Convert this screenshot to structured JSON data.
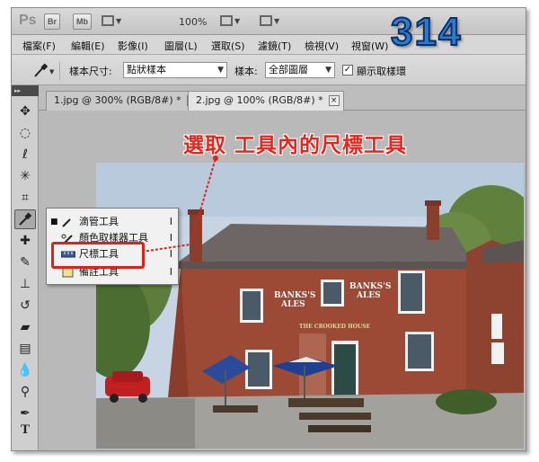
{
  "app": {
    "logo": "Ps",
    "bridge_button": "Br",
    "minibridge_button": "Mb",
    "zoom": "100%",
    "watermark": "314"
  },
  "menu": {
    "items": [
      "檔案(F)",
      "編輯(E)",
      "影像(I)",
      "圖層(L)",
      "選取(S)",
      "濾鏡(T)",
      "檢視(V)",
      "視窗(W)"
    ]
  },
  "options": {
    "sample_size_label": "樣本尺寸:",
    "sample_size_value": "點狀樣本",
    "sample_label": "樣本:",
    "sample_value": "全部圖層",
    "show_ring_label": "顯示取樣環"
  },
  "tabs": [
    {
      "label": "1.jpg @ 300% (RGB/8#) *",
      "close": "×"
    },
    {
      "label": "2.jpg @ 100% (RGB/8#) *",
      "close": "×"
    }
  ],
  "toolbar": {
    "collapse": "▸▸"
  },
  "flyout": {
    "items": [
      {
        "bullet": "■",
        "label": "滴管工具",
        "key": "I"
      },
      {
        "bullet": "",
        "label": "顏色取樣器工具",
        "key": "I"
      },
      {
        "bullet": "",
        "label": "尺標工具",
        "key": "I"
      },
      {
        "bullet": "",
        "label": "備註工具",
        "key": "I"
      }
    ]
  },
  "annotation": {
    "text": "選取 工具內的尺標工具"
  },
  "photo": {
    "sign_left": [
      "BANKS'S",
      "ALES"
    ],
    "sign_right": [
      "BANKS'S",
      "ALES"
    ],
    "pub_name": "THE CROOKED HOUSE"
  },
  "colors": {
    "annotation": "#e8251d",
    "watermark": "#2b7ccf",
    "brick": "#9c4a35",
    "roof": "#6e6664"
  }
}
